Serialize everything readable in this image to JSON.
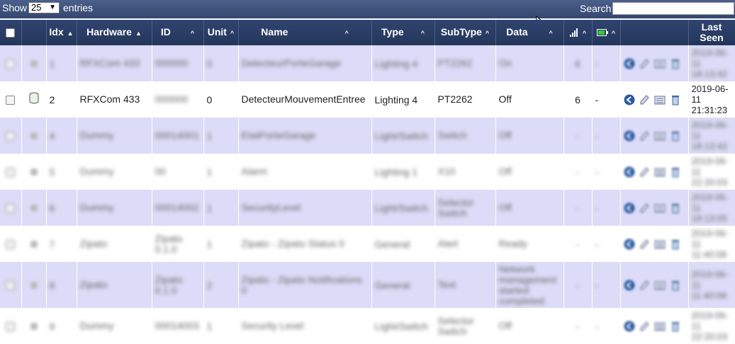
{
  "controls": {
    "show_label": "Show",
    "page_size": "25",
    "entries_label": "entries",
    "search_label": "Search:",
    "search_value": ""
  },
  "columns": [
    "",
    "",
    "Idx",
    "Hardware",
    "ID",
    "Unit",
    "Name",
    "Type",
    "SubType",
    "Data",
    "",
    "",
    "",
    "Last Seen"
  ],
  "focused_row": {
    "idx": "2",
    "hardware": "RFXCom 433",
    "id": "000000",
    "unit": "0",
    "name": "DetecteurMouvementEntree",
    "type": "Lighting 4",
    "subtype": "PT2262",
    "data": "Off",
    "signal": "6",
    "battery": "-",
    "last_seen": "2019-06-11 21:31:23"
  },
  "blurred_rows": [
    {
      "idx": "1",
      "hardware": "RFXCom 433",
      "id": "000000",
      "unit": "0",
      "name": "DetecteurPorteGarage",
      "type": "Lighting 4",
      "subtype": "PT2262",
      "data": "On",
      "signal": "6",
      "battery": "-",
      "last_seen": "2019-06-11 18:13:42"
    },
    {
      "idx": "4",
      "hardware": "Dummy",
      "id": "00014001",
      "unit": "1",
      "name": "EtatPorteGarage",
      "type": "Light/Switch",
      "subtype": "Switch",
      "data": "Off",
      "signal": "-",
      "battery": "-",
      "last_seen": "2019-06-11 18:13:42"
    },
    {
      "idx": "5",
      "hardware": "Dummy",
      "id": "00",
      "unit": "1",
      "name": "Alarm",
      "type": "Lighting 1",
      "subtype": "X10",
      "data": "Off",
      "signal": "-",
      "battery": "-",
      "last_seen": "2019-06-11 22:20:03"
    },
    {
      "idx": "6",
      "hardware": "Dummy",
      "id": "00014002",
      "unit": "1",
      "name": "SecurityLevel",
      "type": "Light/Switch",
      "subtype": "Selector Switch",
      "data": "Off",
      "signal": "-",
      "battery": "-",
      "last_seen": "2019-06-11 18:13:05"
    },
    {
      "idx": "7",
      "hardware": "Zipato",
      "id": "Zipato 0.1.0",
      "unit": "1",
      "name": "Zipato - Zipato Status 0",
      "type": "General",
      "subtype": "Alert",
      "data": "Ready",
      "signal": "-",
      "battery": "-",
      "last_seen": "2019-06-11 11:40:08"
    },
    {
      "idx": "8",
      "hardware": "Zipato",
      "id": "Zipato 0.1.0",
      "unit": "2",
      "name": "Zipato - Zipato Notifications 0",
      "type": "General",
      "subtype": "Text",
      "data": "Network management started completed",
      "signal": "-",
      "battery": "-",
      "last_seen": "2019-06-11 11:40:08"
    },
    {
      "idx": "9",
      "hardware": "Dummy",
      "id": "00014003",
      "unit": "1",
      "name": "Security Level",
      "type": "Light/Switch",
      "subtype": "Selector Switch",
      "data": "Off",
      "signal": "-",
      "battery": "-",
      "last_seen": "2019-06-11 22:20:03"
    }
  ],
  "colors": {
    "header_bg": "#2f446f",
    "odd_row": "#dcdcf8",
    "even_row": "#ffffff",
    "action_blue": "#2a5aa0"
  },
  "icons": [
    "checkbox-icon",
    "signal-icon",
    "battery-icon",
    "back-arrow-icon",
    "edit-icon",
    "log-icon",
    "delete-icon",
    "bulb-icon",
    "cylinder-icon"
  ]
}
